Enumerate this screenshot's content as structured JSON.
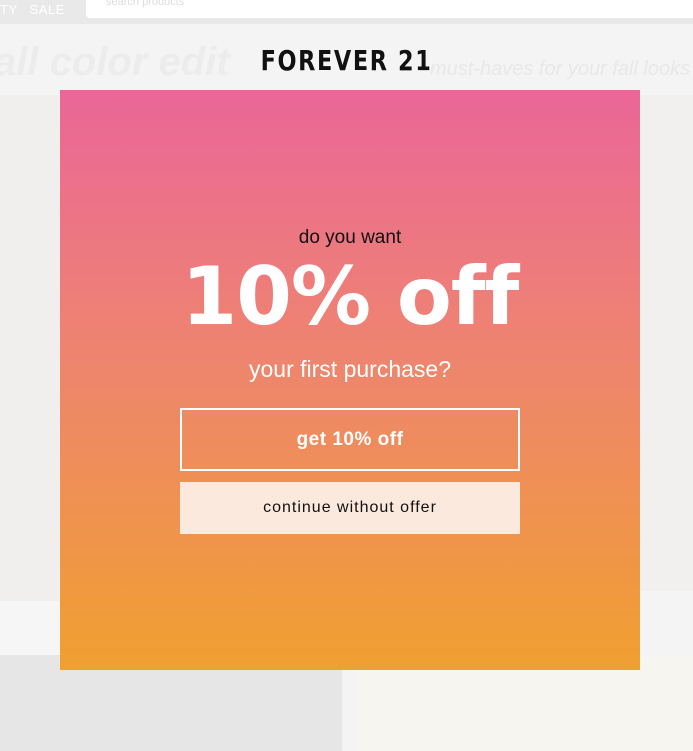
{
  "nav": {
    "links": [
      "TY",
      "SALE"
    ],
    "search_placeholder": "search products"
  },
  "brand": {
    "logo_text": "FOREVER 21"
  },
  "hero": {
    "title": "all color edit",
    "subtitle": "must-haves for your fall looks"
  },
  "modal": {
    "question_top": "do you want",
    "offer": "10% off",
    "question_bottom": "your first purchase?",
    "primary_button": "get 10% off",
    "secondary_button": "continue without offer",
    "colors": {
      "gradient_top": "#ea6698",
      "gradient_mid": "#ee8470",
      "gradient_bottom": "#f0a030",
      "secondary_button_bg": "#fbe9de"
    }
  }
}
